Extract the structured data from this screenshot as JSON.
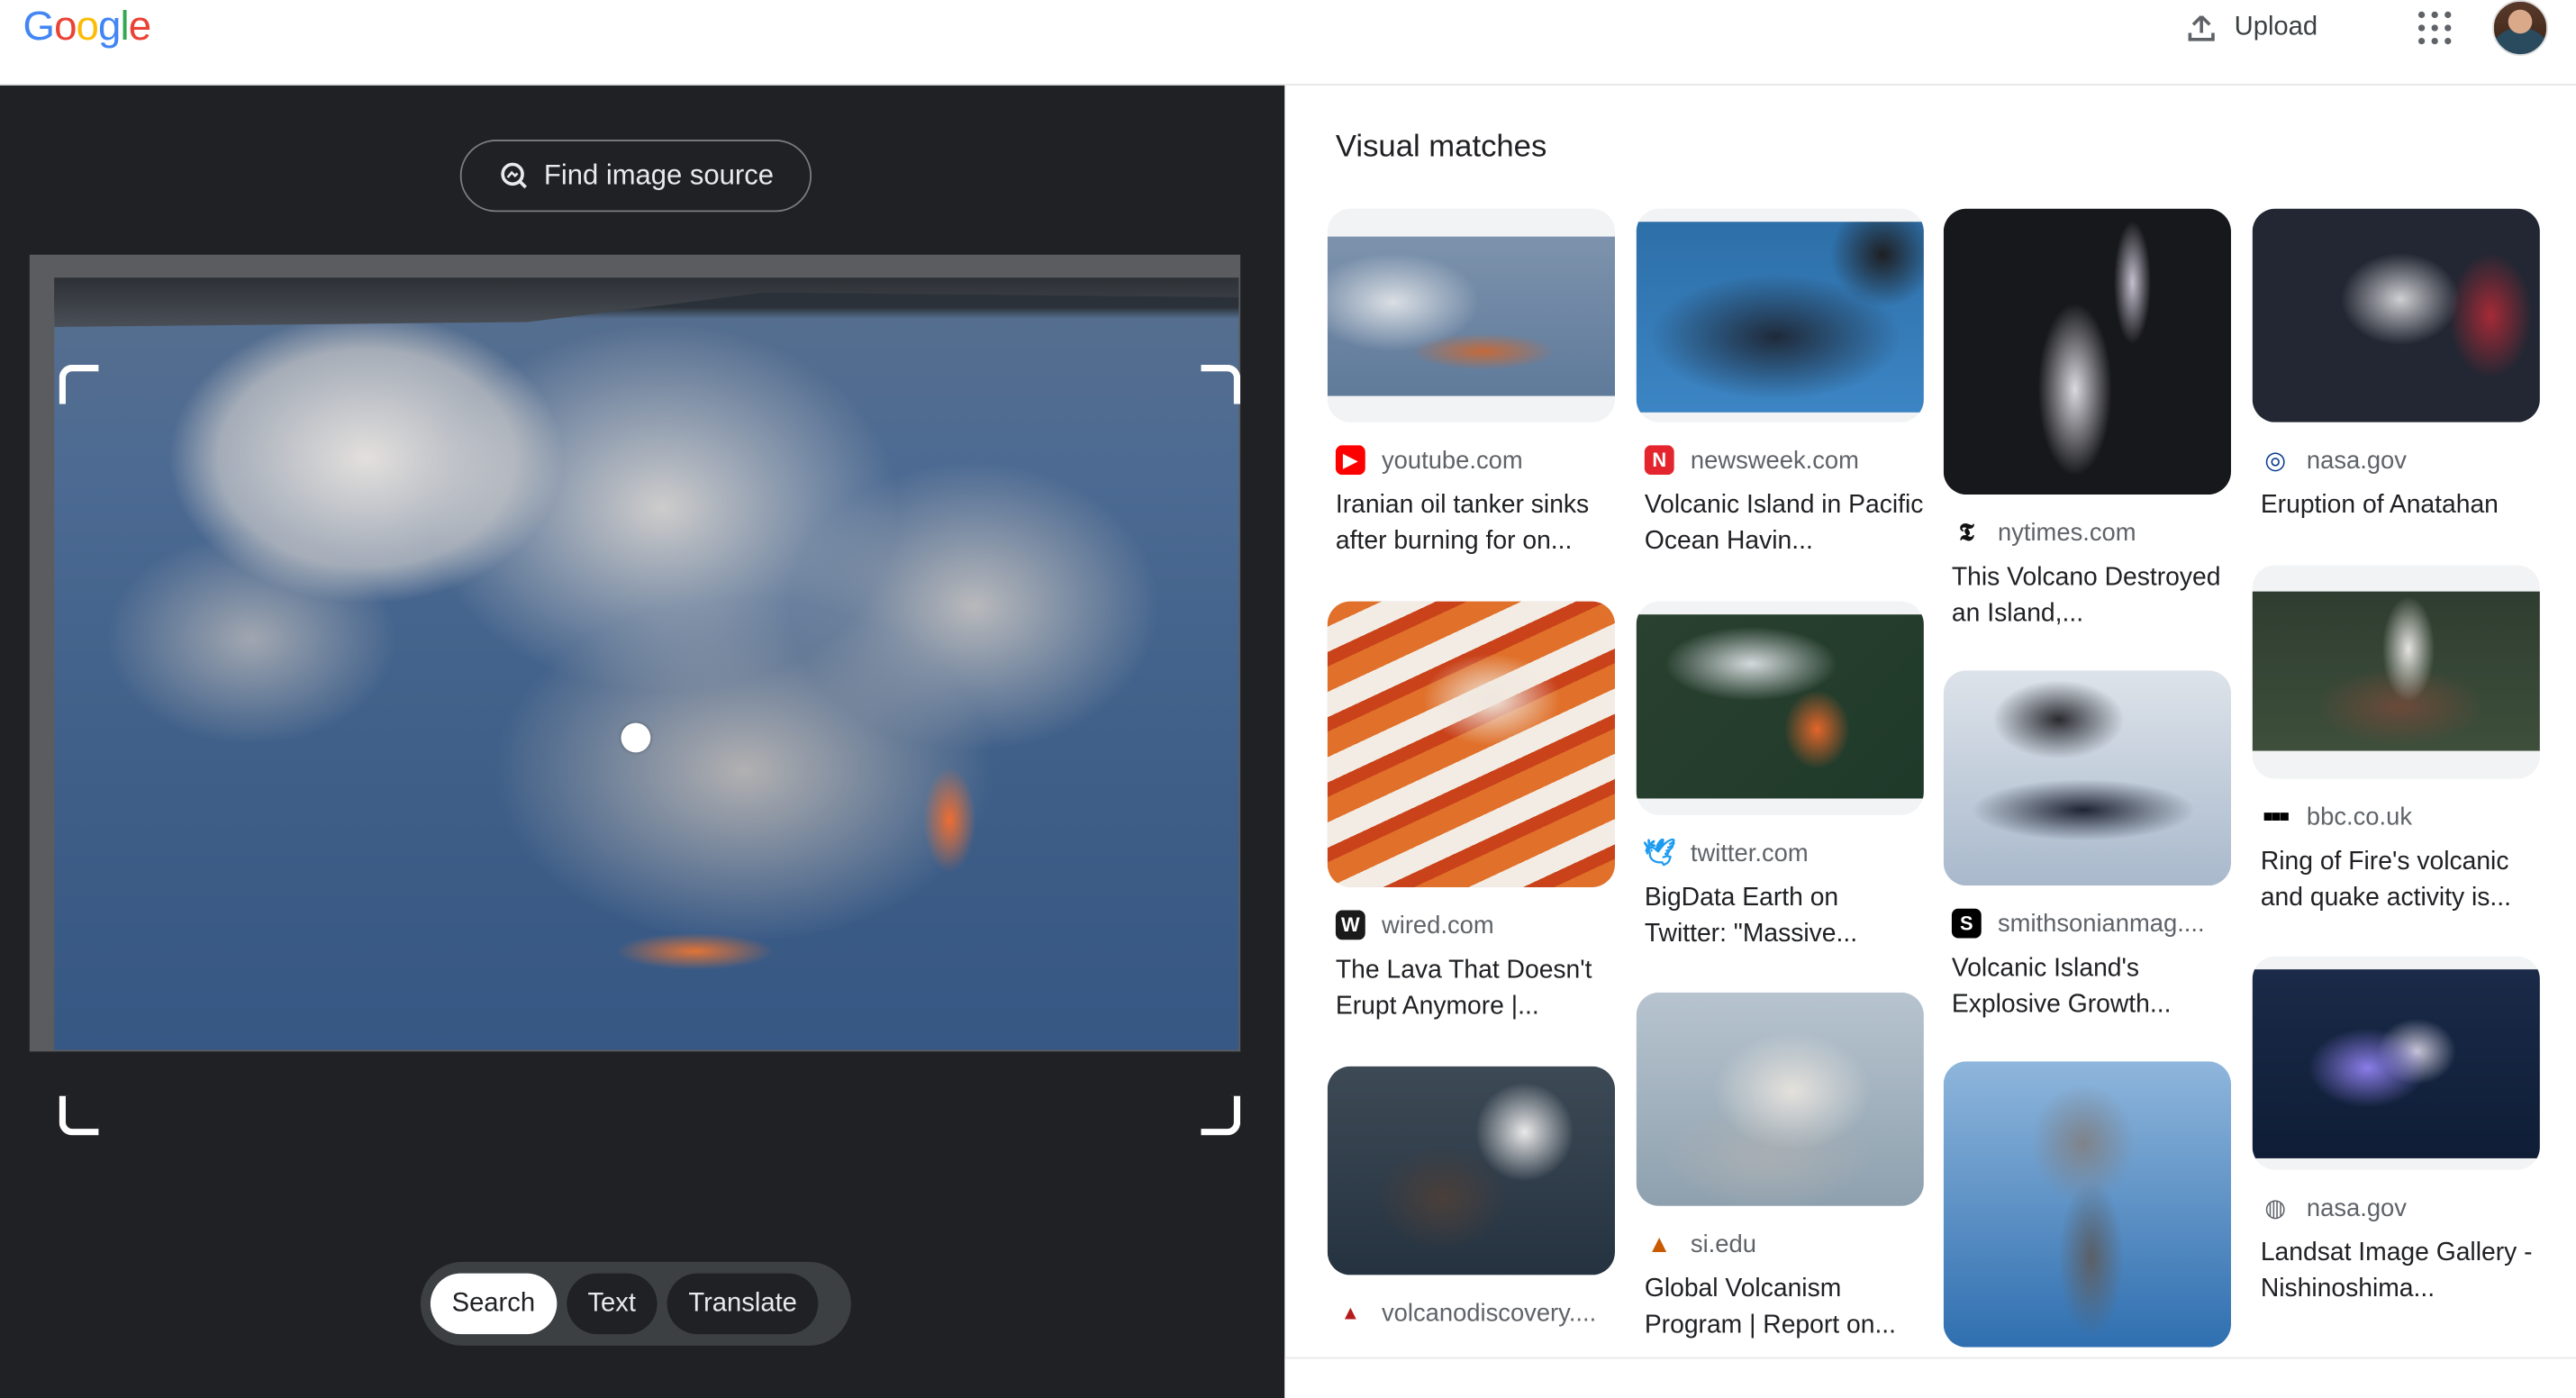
{
  "header": {
    "logo": "Google",
    "upload_label": "Upload"
  },
  "lens": {
    "find_source_label": "Find image source",
    "modes": [
      "Search",
      "Text",
      "Translate"
    ],
    "active_mode": "Search"
  },
  "results": {
    "title": "Visual matches",
    "cards": [
      {
        "source": "youtube.com",
        "title": "Iranian oil tanker sinks after burning for on..."
      },
      {
        "source": "newsweek.com",
        "title": "Volcanic Island in Pacific Ocean Havin..."
      },
      {
        "source": "nytimes.com",
        "title": "This Volcano Destroyed an Island,..."
      },
      {
        "source": "nasa.gov",
        "title": "Eruption of Anatahan"
      },
      {
        "source": "wired.com",
        "title": "The Lava That Doesn't Erupt Anymore |..."
      },
      {
        "source": "twitter.com",
        "title": "BigData Earth on Twitter: \"Massive..."
      },
      {
        "source": "smithsonianmag....",
        "title": "Volcanic Island's Explosive Growth..."
      },
      {
        "source": "bbc.co.uk",
        "title": "Ring of Fire's volcanic and quake activity is..."
      },
      {
        "source": "volcanodiscovery....",
        "title": ""
      },
      {
        "source": "si.edu",
        "title": "Global Volcanism Program | Report on..."
      },
      {
        "source": "nasa.gov",
        "title": "Landsat Image Gallery - Nishinoshima..."
      }
    ]
  },
  "colors": {
    "left_bg": "#202124",
    "logo_blue": "#4285F4",
    "logo_red": "#EA4335",
    "logo_yellow": "#FBBC05",
    "logo_green": "#34A853"
  }
}
